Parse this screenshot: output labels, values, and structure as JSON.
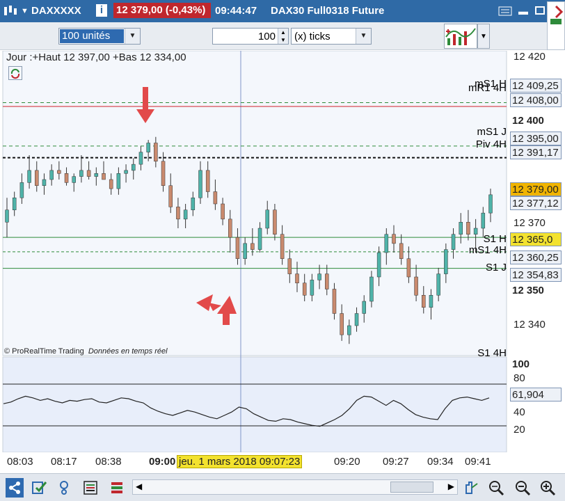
{
  "title_bar": {
    "symbol": "DAXXXXX",
    "price_change": "12 379,00 (-0,43%)",
    "time": "09:44:47",
    "instrument": "DAX30 Full0318 Future"
  },
  "toolbar": {
    "units_value": "100 unités",
    "ticks_count": "100",
    "ticks_unit": "(x) ticks"
  },
  "chart": {
    "header": "Jour :+Haut 12 397,00 +Bas 12 334,00",
    "watermark": "© ProRealTime Trading",
    "watermark_note": "Données en temps réel",
    "cursor_date": "jeu. 1 mars 2018 09:07:23",
    "y_labels": [
      "12 420",
      "12 400",
      "12 370",
      "12 350",
      "12 340"
    ],
    "levels": [
      {
        "label": "mS1 H",
        "value": "12 409,25",
        "color": "#2e8b3a"
      },
      {
        "label": "mR1 4H",
        "value": "12 408,00",
        "color": "#d0202a"
      },
      {
        "label": "mS1 J",
        "value": "12 395,00",
        "color": "#2e8b3a"
      },
      {
        "label": "Piv 4H",
        "value": "12 391,17",
        "color": "#222222"
      },
      {
        "label": "",
        "value": "12 379,00",
        "color": "#f0b400"
      },
      {
        "label": "",
        "value": "12 377,12",
        "color": "#222222"
      },
      {
        "label": "S1 H",
        "value": "12 365,0",
        "color": "#2e8b3a"
      },
      {
        "label": "mS1 4H",
        "value": "12 360,25",
        "color": "#2e8b3a"
      },
      {
        "label": "S1 J",
        "value": "12 354,83",
        "color": "#2e8b3a"
      },
      {
        "label": "S1 4H",
        "value": "",
        "color": "#2e8b3a"
      }
    ],
    "x_labels": [
      "08:03",
      "08:17",
      "08:38",
      "09:00",
      "09:20",
      "09:27",
      "09:34",
      "09:41"
    ]
  },
  "indicator": {
    "y_labels": [
      "100",
      "80",
      "40",
      "20"
    ],
    "value": "61,904"
  },
  "chart_data": {
    "type": "candlestick",
    "ylim": [
      12328,
      12424
    ],
    "levels": [
      12409.25,
      12408.0,
      12395.0,
      12391.17,
      12379.0,
      12377.12,
      12365.0,
      12360.25,
      12354.83
    ],
    "candles": [
      [
        12370,
        12378,
        12365,
        12374
      ],
      [
        12374,
        12380,
        12372,
        12378
      ],
      [
        12378,
        12386,
        12376,
        12383
      ],
      [
        12383,
        12392,
        12381,
        12387
      ],
      [
        12387,
        12390,
        12380,
        12382
      ],
      [
        12382,
        12386,
        12379,
        12384
      ],
      [
        12384,
        12389,
        12382,
        12387
      ],
      [
        12387,
        12390,
        12384,
        12386
      ],
      [
        12386,
        12388,
        12382,
        12383
      ],
      [
        12383,
        12386,
        12380,
        12385
      ],
      [
        12385,
        12392,
        12383,
        12387
      ],
      [
        12387,
        12390,
        12384,
        12385
      ],
      [
        12385,
        12388,
        12382,
        12386
      ],
      [
        12386,
        12390,
        12384,
        12384
      ],
      [
        12384,
        12386,
        12379,
        12381
      ],
      [
        12381,
        12388,
        12379,
        12386
      ],
      [
        12386,
        12389,
        12383,
        12387
      ],
      [
        12387,
        12391,
        12384,
        12389
      ],
      [
        12389,
        12395,
        12387,
        12393
      ],
      [
        12393,
        12397,
        12390,
        12396
      ],
      [
        12396,
        12398,
        12388,
        12390
      ],
      [
        12390,
        12393,
        12380,
        12382
      ],
      [
        12382,
        12386,
        12373,
        12375
      ],
      [
        12375,
        12378,
        12368,
        12371
      ],
      [
        12371,
        12376,
        12368,
        12374
      ],
      [
        12374,
        12380,
        12372,
        12378
      ],
      [
        12378,
        12390,
        12376,
        12387
      ],
      [
        12387,
        12390,
        12378,
        12380
      ],
      [
        12380,
        12384,
        12374,
        12376
      ],
      [
        12376,
        12378,
        12369,
        12371
      ],
      [
        12371,
        12374,
        12360,
        12365
      ],
      [
        12365,
        12368,
        12356,
        12358
      ],
      [
        12358,
        12365,
        12356,
        12363
      ],
      [
        12363,
        12368,
        12359,
        12361
      ],
      [
        12361,
        12370,
        12360,
        12368
      ],
      [
        12368,
        12377,
        12366,
        12374
      ],
      [
        12374,
        12376,
        12364,
        12366
      ],
      [
        12366,
        12369,
        12356,
        12358
      ],
      [
        12358,
        12361,
        12350,
        12353
      ],
      [
        12353,
        12357,
        12347,
        12350
      ],
      [
        12350,
        12353,
        12344,
        12346
      ],
      [
        12346,
        12353,
        12344,
        12351
      ],
      [
        12351,
        12356,
        12348,
        12353
      ],
      [
        12353,
        12356,
        12346,
        12348
      ],
      [
        12348,
        12350,
        12338,
        12340
      ],
      [
        12340,
        12343,
        12331,
        12333
      ],
      [
        12333,
        12338,
        12330,
        12336
      ],
      [
        12336,
        12342,
        12334,
        12340
      ],
      [
        12340,
        12346,
        12337,
        12344
      ],
      [
        12344,
        12354,
        12342,
        12352
      ],
      [
        12352,
        12362,
        12349,
        12360
      ],
      [
        12360,
        12368,
        12356,
        12366
      ],
      [
        12366,
        12369,
        12360,
        12363
      ],
      [
        12363,
        12366,
        12356,
        12358
      ],
      [
        12358,
        12362,
        12350,
        12352
      ],
      [
        12352,
        12356,
        12344,
        12346
      ],
      [
        12346,
        12349,
        12340,
        12342
      ],
      [
        12342,
        12348,
        12338,
        12346
      ],
      [
        12346,
        12355,
        12344,
        12353
      ],
      [
        12353,
        12363,
        12350,
        12361
      ],
      [
        12361,
        12368,
        12358,
        12366
      ],
      [
        12366,
        12373,
        12363,
        12370
      ],
      [
        12370,
        12374,
        12364,
        12366
      ],
      [
        12366,
        12371,
        12360,
        12368
      ],
      [
        12368,
        12375,
        12365,
        12373
      ],
      [
        12373,
        12381,
        12370,
        12379
      ]
    ],
    "indicator": [
      54,
      56,
      60,
      63,
      61,
      58,
      60,
      57,
      55,
      58,
      57,
      59,
      60,
      56,
      55,
      58,
      61,
      60,
      57,
      55,
      49,
      45,
      42,
      40,
      43,
      46,
      44,
      41,
      38,
      36,
      40,
      44,
      50,
      48,
      42,
      38,
      34,
      33,
      36,
      35,
      32,
      30,
      28,
      27,
      31,
      35,
      40,
      48,
      58,
      63,
      62,
      57,
      52,
      58,
      54,
      47,
      41,
      38,
      36,
      35,
      48,
      58,
      61,
      62,
      60,
      58,
      61
    ]
  }
}
